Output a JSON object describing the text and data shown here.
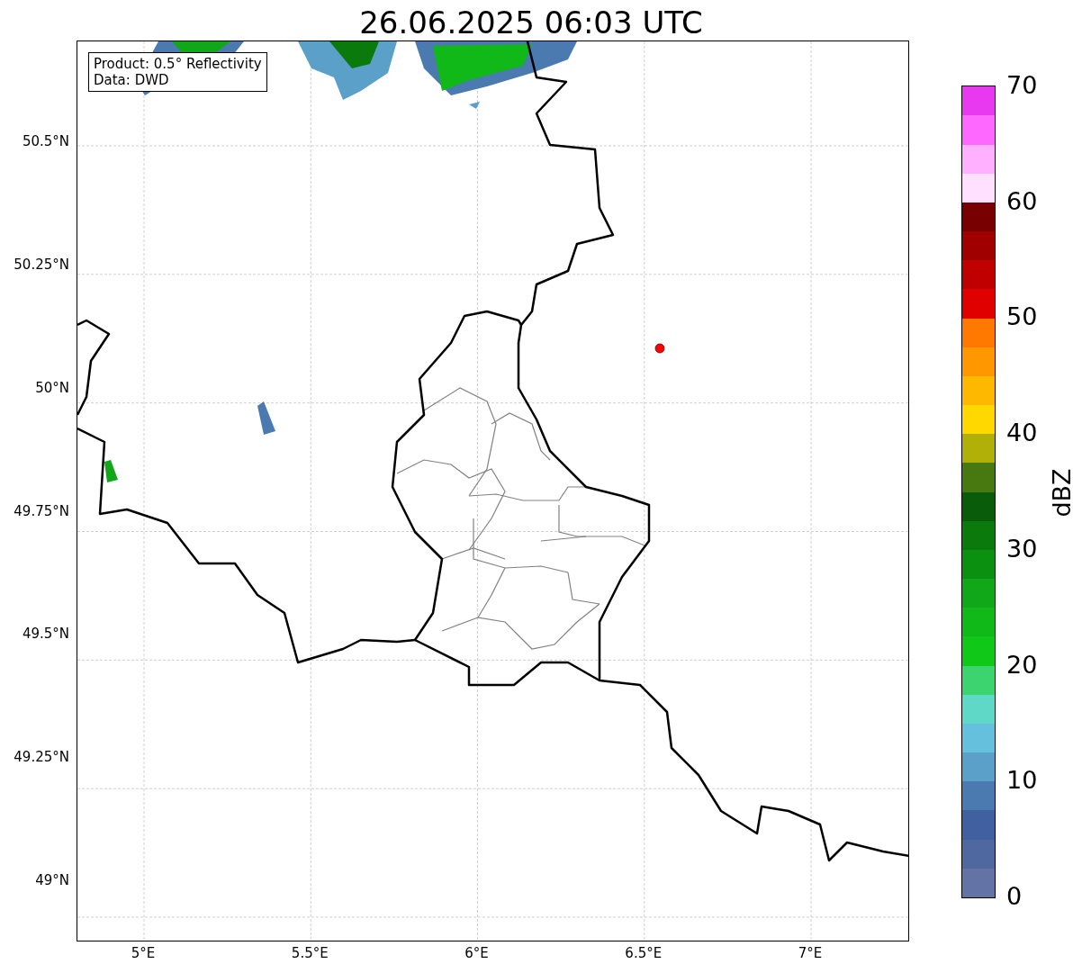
{
  "title": "26.06.2025 06:03 UTC",
  "info_box": [
    "Product: 0.5° Reflectivity",
    "Data: DWD"
  ],
  "map": {
    "xticks": [
      "5°E",
      "5.5°E",
      "6°E",
      "6.5°E",
      "7°E"
    ],
    "yticks": [
      "50.5°N",
      "50.25°N",
      "50°N",
      "49.75°N",
      "49.5°N",
      "49.25°N",
      "49°N"
    ]
  },
  "colorbar": {
    "label": "dBZ",
    "ticks": [
      "70",
      "60",
      "50",
      "40",
      "30",
      "20",
      "10",
      "0"
    ],
    "segments": [
      {
        "color": "#6373a6"
      },
      {
        "color": "#5068a0"
      },
      {
        "color": "#4060a0"
      },
      {
        "color": "#4a7ab0"
      },
      {
        "color": "#5aa0c8"
      },
      {
        "color": "#64c0dc"
      },
      {
        "color": "#5fd8c8"
      },
      {
        "color": "#3cd46e"
      },
      {
        "color": "#10c818"
      },
      {
        "color": "#10b818"
      },
      {
        "color": "#10a818"
      },
      {
        "color": "#0c9010"
      },
      {
        "color": "#0a7a0c"
      },
      {
        "color": "#085c0a"
      },
      {
        "color": "#487810"
      },
      {
        "color": "#b0b008"
      },
      {
        "color": "#ffd800"
      },
      {
        "color": "#ffb800"
      },
      {
        "color": "#ff9800"
      },
      {
        "color": "#ff7800"
      },
      {
        "color": "#e00000"
      },
      {
        "color": "#c00000"
      },
      {
        "color": "#a00000"
      },
      {
        "color": "#780000"
      },
      {
        "color": "#ffe0ff"
      },
      {
        "color": "#ffb0ff"
      },
      {
        "color": "#ff68ff"
      },
      {
        "color": "#e838f0"
      }
    ]
  }
}
